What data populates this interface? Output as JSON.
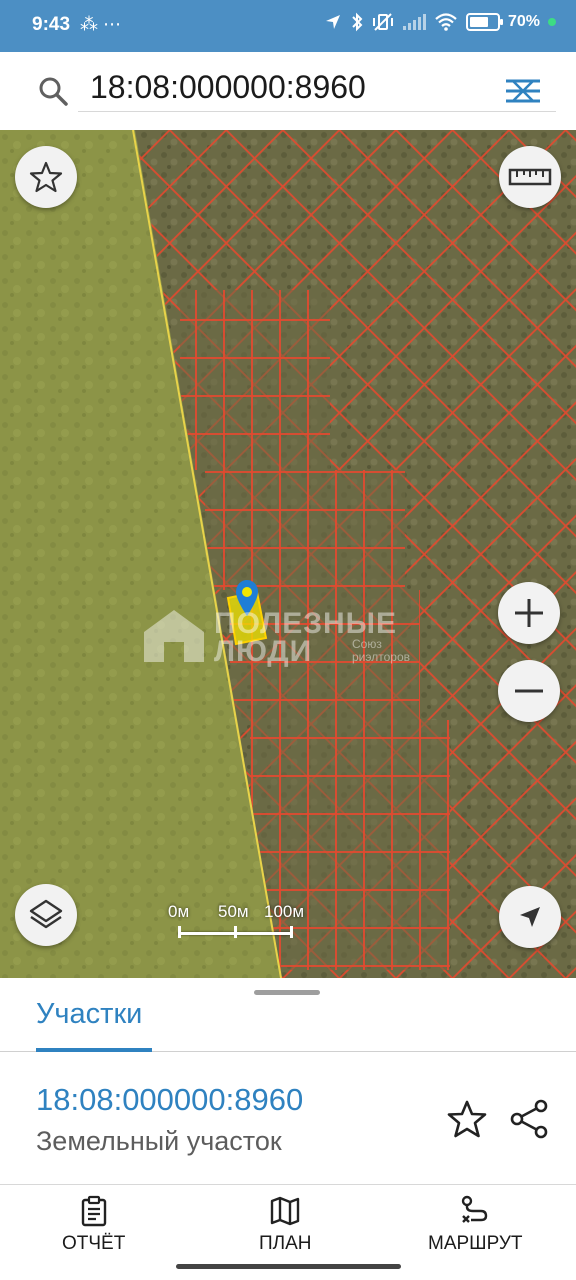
{
  "status": {
    "time": "9:43",
    "left_icons": "⁂ ⋯",
    "battery": "70",
    "battery_level": 0.7,
    "icons": [
      "location-arrow-icon",
      "bluetooth-icon",
      "vibrate-off-icon",
      "signal-icon",
      "wifi-icon",
      "battery-icon"
    ]
  },
  "search": {
    "value": "18:08:000000:8960",
    "icon": "search-icon",
    "action_icon": "filter-icon"
  },
  "map": {
    "scale": {
      "labels": [
        "0м",
        "50м",
        "100м"
      ]
    },
    "buttons": [
      "favorites-star-icon",
      "ruler-icon",
      "zoom-in-icon",
      "zoom-out-icon",
      "layers-icon",
      "my-location-icon"
    ],
    "watermark": {
      "text": "ПОЛЕЗНЫЕ\nЛЮДИ",
      "sub": "Союз\nриэлторов"
    },
    "colors": {
      "parcel_lines": "#e24a2f",
      "selected_fill": "#f2e600",
      "boundary": "#e8d34a",
      "marker": "#1f7ed6"
    }
  },
  "sheet": {
    "tab_label": "Участки",
    "parcel": {
      "id": "18:08:000000:8960",
      "type": "Земельный участок"
    },
    "accent_color": "#2f82c0"
  },
  "nav": {
    "report": "ОТЧЁТ",
    "plan": "ПЛАН",
    "route": "МАРШРУТ"
  }
}
